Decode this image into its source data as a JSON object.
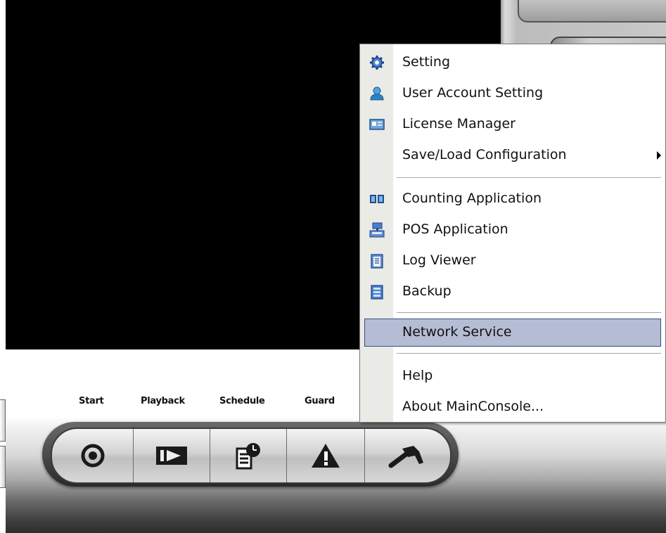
{
  "toolbar": {
    "labels": [
      "Start",
      "Playback",
      "Schedule",
      "Guard"
    ],
    "buttons": [
      {
        "name": "start-button",
        "icon": "record-icon"
      },
      {
        "name": "playback-button",
        "icon": "play-icon"
      },
      {
        "name": "schedule-button",
        "icon": "schedule-icon"
      },
      {
        "name": "guard-button",
        "icon": "warning-icon"
      },
      {
        "name": "tools-button",
        "icon": "hammer-icon"
      }
    ]
  },
  "menu": {
    "items": [
      {
        "label": "Setting",
        "icon": "gear-icon"
      },
      {
        "label": "User Account Setting",
        "icon": "user-icon"
      },
      {
        "label": "License Manager",
        "icon": "license-card-icon"
      },
      {
        "label": "Save/Load Configuration",
        "icon": "",
        "submenu": true
      },
      {
        "label": "Counting Application",
        "icon": "counter-icon"
      },
      {
        "label": "POS Application",
        "icon": "pos-terminal-icon"
      },
      {
        "label": "Log Viewer",
        "icon": "clipboard-icon"
      },
      {
        "label": "Backup",
        "icon": "backup-icon"
      },
      {
        "label": "Network Service",
        "icon": "",
        "highlighted": true
      },
      {
        "label": "Help",
        "icon": ""
      },
      {
        "label": "About MainConsole...",
        "icon": ""
      }
    ]
  },
  "colors": {
    "menu_highlight": "#b5bdd4",
    "menu_highlight_border": "#3a4d82",
    "menu_gutter": "#eaeae6",
    "video_background": "#000000"
  }
}
